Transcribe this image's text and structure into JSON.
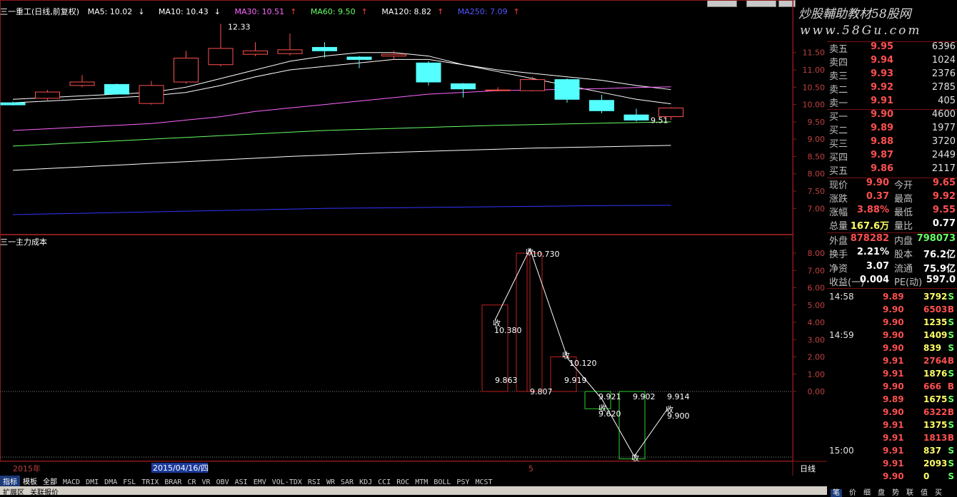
{
  "header": {
    "title": "三一重工(日线,前复权)",
    "ma5": "MA5: 10.02",
    "ma10": "MA10: 10.43",
    "ma30": "MA30: 10.51",
    "ma60": "MA60: 9.50",
    "ma120": "MA120: 8.82",
    "ma250": "MA250: 7.09"
  },
  "indicator_title": "三一主力成本",
  "watermark": {
    "line1": "炒股輔助教材58股网",
    "line2": "www.58Gu.com"
  },
  "price_axis": [
    "11.50",
    "11.00",
    "10.50",
    "10.00",
    "9.50",
    "9.00",
    "8.50",
    "8.00",
    "7.50",
    "7.00"
  ],
  "ind_axis": [
    "8.00",
    "7.00",
    "6.00",
    "5.00",
    "4.00",
    "3.00",
    "2.00",
    "1.00",
    "0.00"
  ],
  "annotations": {
    "high": "12.33",
    "low": "9.51",
    "ind_labels": [
      "10.730",
      "10.380",
      "9.863",
      "9.807",
      "10.120",
      "9.919",
      "9.921",
      "9.620",
      "9.902",
      "9.914",
      "9.900"
    ],
    "collect": "收"
  },
  "date_bar": {
    "year": "2015年",
    "date": "2015/04/16/四",
    "month": "5"
  },
  "period_label": "日线",
  "orderbook": [
    {
      "label": "卖五",
      "price": "9.95",
      "vol": "6396"
    },
    {
      "label": "卖四",
      "price": "9.94",
      "vol": "1024"
    },
    {
      "label": "卖三",
      "price": "9.93",
      "vol": "2376"
    },
    {
      "label": "卖二",
      "price": "9.92",
      "vol": "2785"
    },
    {
      "label": "卖一",
      "price": "9.91",
      "vol": "405"
    },
    {
      "label": "买一",
      "price": "9.90",
      "vol": "4600"
    },
    {
      "label": "买二",
      "price": "9.89",
      "vol": "1977"
    },
    {
      "label": "买三",
      "price": "9.88",
      "vol": "3720"
    },
    {
      "label": "买四",
      "price": "9.87",
      "vol": "2449"
    },
    {
      "label": "买五",
      "price": "9.86",
      "vol": "2117"
    }
  ],
  "stats": {
    "r1": {
      "l1": "现价",
      "v1": "9.90",
      "l2": "今开",
      "v2": "9.65"
    },
    "r2": {
      "l1": "涨跌",
      "v1": "0.37",
      "l2": "最高",
      "v2": "9.92"
    },
    "r3": {
      "l1": "涨幅",
      "v1": "3.88%",
      "l2": "最低",
      "v2": "9.55"
    },
    "r4": {
      "l1": "总量",
      "v1": "167.6万",
      "l2": "量比",
      "v2": "0.77"
    },
    "r5": {
      "l1": "外盘",
      "v1": "878282",
      "l2": "内盘",
      "v2": "798073"
    },
    "r6": {
      "l1": "换手",
      "v1": "2.21%",
      "l2": "股本",
      "v2": "76.2亿"
    },
    "r7": {
      "l1": "净资",
      "v1": "3.07",
      "l2": "流通",
      "v2": "75.9亿"
    },
    "r8": {
      "l1": "收益(一)",
      "v1": "0.004",
      "l2": "PE(动)",
      "v2": "597.0"
    }
  },
  "ticks": [
    {
      "time": "14:58",
      "price": "9.89",
      "vol": "3792",
      "side": "S"
    },
    {
      "time": "",
      "price": "9.90",
      "vol": "6503",
      "side": "B"
    },
    {
      "time": "",
      "price": "9.90",
      "vol": "1235",
      "side": "S"
    },
    {
      "time": "14:59",
      "price": "9.90",
      "vol": "1409",
      "side": "S"
    },
    {
      "time": "",
      "price": "9.90",
      "vol": "839",
      "side": "S"
    },
    {
      "time": "",
      "price": "9.91",
      "vol": "2764",
      "side": "B"
    },
    {
      "time": "",
      "price": "9.91",
      "vol": "1876",
      "side": "S"
    },
    {
      "time": "",
      "price": "9.90",
      "vol": "666",
      "side": "B"
    },
    {
      "time": "",
      "price": "9.89",
      "vol": "1675",
      "side": "S"
    },
    {
      "time": "",
      "price": "9.90",
      "vol": "6322",
      "side": "B"
    },
    {
      "time": "",
      "price": "9.91",
      "vol": "1375",
      "side": "S"
    },
    {
      "time": "",
      "price": "9.91",
      "vol": "1813",
      "side": "B"
    },
    {
      "time": "15:00",
      "price": "9.91",
      "vol": "837",
      "side": "S"
    },
    {
      "time": "",
      "price": "9.91",
      "vol": "2093",
      "side": "S"
    },
    {
      "time": "",
      "price": "9.90",
      "vol": "0",
      "side": "S"
    }
  ],
  "tabs": [
    "指标",
    "模板",
    "全部",
    "MACD",
    "DMI",
    "DMA",
    "FSL",
    "TRIX",
    "BRAR",
    "CR",
    "VR",
    "OBV",
    "ASI",
    "EMV",
    "VOL-TDX",
    "RSI",
    "WR",
    "SAR",
    "KDJ",
    "CCI",
    "ROC",
    "MTM",
    "BOLL",
    "PSY",
    "MCST"
  ],
  "bottom_links": [
    "扩展区",
    "关联报价"
  ],
  "side_tabs": [
    "笔",
    "价",
    "细",
    "盘",
    "势",
    "联",
    "值",
    "买"
  ],
  "chart_data": {
    "type": "candlestick",
    "title": "三一重工(日线,前复权)",
    "ylim": [
      6.8,
      12.4
    ],
    "candles": [
      {
        "open": 10.05,
        "close": 9.99,
        "high": 10.08,
        "low": 9.97
      },
      {
        "open": 10.18,
        "close": 10.36,
        "high": 10.42,
        "low": 10.12
      },
      {
        "open": 10.55,
        "close": 10.65,
        "high": 10.85,
        "low": 10.5
      },
      {
        "open": 10.58,
        "close": 10.3,
        "high": 10.6,
        "low": 10.28
      },
      {
        "open": 10.03,
        "close": 10.55,
        "high": 10.68,
        "low": 10.0
      },
      {
        "open": 10.65,
        "close": 11.34,
        "high": 11.55,
        "low": 10.6
      },
      {
        "open": 11.15,
        "close": 11.62,
        "high": 12.33,
        "low": 11.1
      },
      {
        "open": 11.45,
        "close": 11.55,
        "high": 11.8,
        "low": 11.4
      },
      {
        "open": 11.47,
        "close": 11.58,
        "high": 12.05,
        "low": 11.42
      },
      {
        "open": 11.65,
        "close": 11.55,
        "high": 11.8,
        "low": 11.35
      },
      {
        "open": 11.37,
        "close": 11.3,
        "high": 11.4,
        "low": 11.05
      },
      {
        "open": 11.4,
        "close": 11.45,
        "high": 11.55,
        "low": 11.3
      },
      {
        "open": 11.2,
        "close": 10.65,
        "high": 11.25,
        "low": 10.55
      },
      {
        "open": 10.6,
        "close": 10.45,
        "high": 10.62,
        "low": 10.2
      },
      {
        "open": 10.4,
        "close": 10.42,
        "high": 10.5,
        "low": 10.38
      },
      {
        "open": 10.4,
        "close": 10.72,
        "high": 10.8,
        "low": 10.38
      },
      {
        "open": 10.72,
        "close": 10.15,
        "high": 10.75,
        "low": 10.05
      },
      {
        "open": 10.12,
        "close": 9.82,
        "high": 10.28,
        "low": 9.75
      },
      {
        "open": 9.7,
        "close": 9.55,
        "high": 9.88,
        "low": 9.51
      },
      {
        "open": 9.65,
        "close": 9.9,
        "high": 9.92,
        "low": 9.55
      }
    ],
    "ma_series": [
      {
        "name": "MA5",
        "color": "#ffffff",
        "values": [
          10.15,
          10.2,
          10.25,
          10.3,
          10.35,
          10.5,
          10.75,
          11.0,
          11.25,
          11.4,
          11.5,
          11.5,
          11.4,
          11.15,
          10.95,
          10.75,
          10.55,
          10.35,
          10.15,
          10.02
        ]
      },
      {
        "name": "MA10",
        "color": "#ffffff",
        "values": [
          10.05,
          10.1,
          10.15,
          10.2,
          10.25,
          10.35,
          10.55,
          10.8,
          11.0,
          11.1,
          11.2,
          11.3,
          11.3,
          11.15,
          11.0,
          10.9,
          10.8,
          10.7,
          10.55,
          10.43
        ]
      },
      {
        "name": "MA30",
        "color": "#ff66ff",
        "values": [
          9.25,
          9.3,
          9.35,
          9.4,
          9.45,
          9.55,
          9.65,
          9.8,
          9.9,
          10.0,
          10.1,
          10.2,
          10.3,
          10.35,
          10.4,
          10.42,
          10.44,
          10.46,
          10.49,
          10.51
        ]
      },
      {
        "name": "MA60",
        "color": "#66ff66",
        "values": [
          8.8,
          8.85,
          8.9,
          8.95,
          9.0,
          9.05,
          9.1,
          9.15,
          9.2,
          9.25,
          9.28,
          9.31,
          9.34,
          9.37,
          9.4,
          9.42,
          9.44,
          9.46,
          9.48,
          9.5
        ]
      },
      {
        "name": "MA120",
        "color": "#ffffff",
        "values": [
          8.1,
          8.15,
          8.2,
          8.25,
          8.3,
          8.35,
          8.4,
          8.45,
          8.5,
          8.54,
          8.58,
          8.62,
          8.65,
          8.68,
          8.71,
          8.74,
          8.76,
          8.78,
          8.8,
          8.82
        ]
      },
      {
        "name": "MA250",
        "color": "#3333ff",
        "values": [
          6.82,
          6.84,
          6.86,
          6.88,
          6.9,
          6.92,
          6.94,
          6.96,
          6.98,
          7.0,
          7.01,
          7.02,
          7.03,
          7.04,
          7.05,
          7.06,
          7.07,
          7.08,
          7.085,
          7.09
        ]
      }
    ]
  }
}
